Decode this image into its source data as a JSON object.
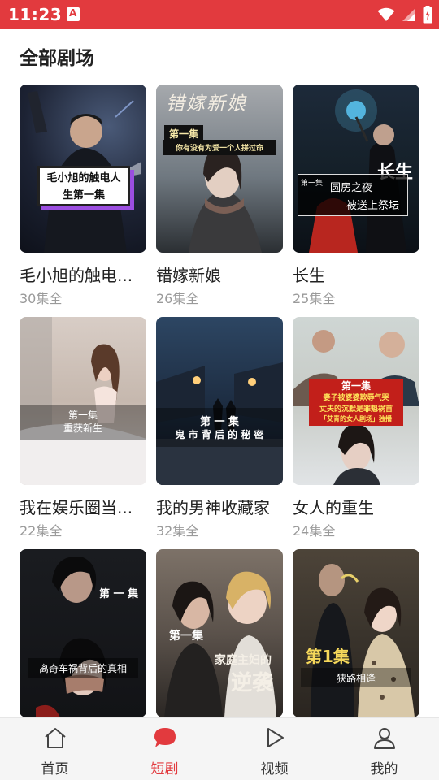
{
  "status_bar": {
    "time": "11:23",
    "app_badge": "A"
  },
  "page": {
    "title": "全部剧场"
  },
  "dramas": [
    {
      "title": "毛小旭的触电...",
      "episodes": "30集全",
      "overlay": [
        "毛小旭的触电人",
        "生第一集"
      ]
    },
    {
      "title": "错嫁新娘",
      "episodes": "26集全",
      "overlay": [
        "错嫁新娘",
        "第一集",
        "你有没有为爱一个人拼过命"
      ]
    },
    {
      "title": "长生",
      "episodes": "25集全",
      "overlay": [
        "长生",
        "第一集",
        "圆房之夜",
        "被送上祭坛"
      ]
    },
    {
      "title": "我在娱乐圈当...",
      "episodes": "22集全",
      "overlay": [
        "第一集",
        "重获新生"
      ]
    },
    {
      "title": "我的男神收藏家",
      "episodes": "32集全",
      "overlay": [
        "第 一 集",
        "鬼 市 背 后 的 秘 密"
      ]
    },
    {
      "title": "女人的重生",
      "episodes": "24集全",
      "overlay": [
        "第一集",
        "妻子被婆婆欺辱气哭",
        "丈夫的沉默是罪魁祸首",
        "「艾青的女人剧场」独播"
      ]
    },
    {
      "title": "",
      "episodes": "",
      "overlay": [
        "第 一 集",
        "离奇车祸背后的真相"
      ]
    },
    {
      "title": "",
      "episodes": "",
      "overlay": [
        "第一集",
        "家庭主妇的",
        "逆袭"
      ]
    },
    {
      "title": "",
      "episodes": "",
      "overlay": [
        "第1集",
        "狭路相逢"
      ]
    }
  ],
  "nav": [
    {
      "label": "首页",
      "icon": "home-icon"
    },
    {
      "label": "短剧",
      "icon": "chat-bubble-icon",
      "active": true
    },
    {
      "label": "视频",
      "icon": "play-icon"
    },
    {
      "label": "我的",
      "icon": "person-icon"
    }
  ],
  "colors": {
    "accent": "#e23a3e",
    "nav_bg": "#f5f5f5",
    "subtitle": "#9a9a9a"
  }
}
